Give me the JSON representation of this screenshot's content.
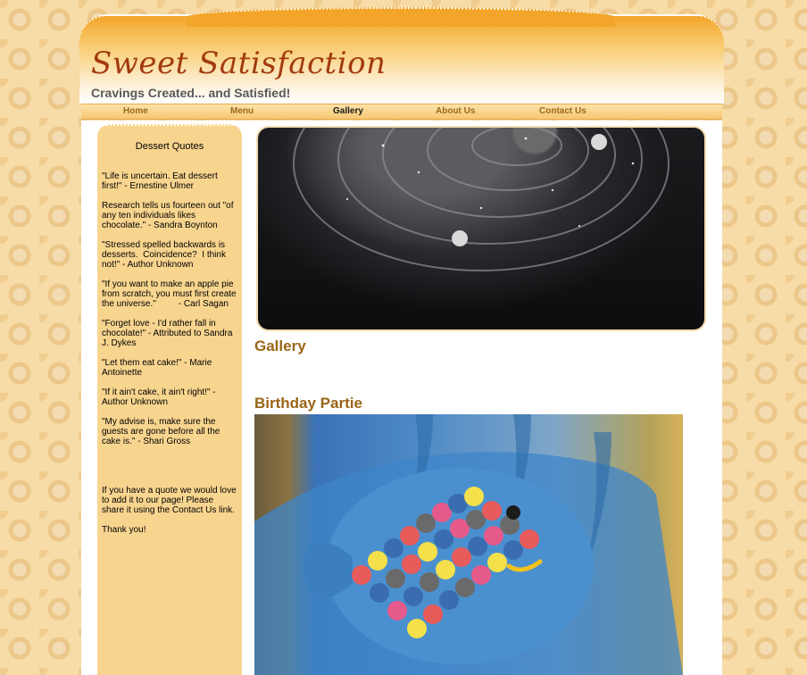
{
  "site": {
    "title": "Sweet Satisfaction",
    "tagline": "Cravings Created... and Satisfied!"
  },
  "nav": {
    "items": [
      {
        "label": "Home",
        "active": false
      },
      {
        "label": "Menu",
        "active": false
      },
      {
        "label": "Gallery",
        "active": true
      },
      {
        "label": "About Us",
        "active": false
      },
      {
        "label": "Contact Us",
        "active": false
      }
    ]
  },
  "sidebar": {
    "heading": "Dessert Quotes",
    "quotes": [
      "\"Life is uncertain. Eat dessert first!\" - Ernestine Ulmer",
      "Research tells us fourteen out \"of any ten individuals likes chocolate.\" - Sandra Boynton",
      "\"Stressed spelled backwards is desserts.  Coincidence?  I think not!\" - Author Unknown",
      "\"If you want to make an apple pie from scratch, you must first create the universe.\"         - Carl Sagan",
      "\"Forget love - I'd rather fall in chocolate!\" - Attributed to Sandra J. Dykes",
      "\"Let them eat cake!\" - Marie Antoinette",
      "\"If it ain't cake, it ain't right!\" - Author Unknown",
      "\"My advise is, make sure the guests are gone before all the cake is.\" - Shari Gross",
      "If you have a quote we would love to add it to our page! Please share it using the Contact Us link.",
      "Thank you!"
    ]
  },
  "main": {
    "heading": "Gallery",
    "section_heading": "Birthday Partie"
  },
  "colors": {
    "accent": "#f3a52a",
    "title": "#a23a0e",
    "heading": "#9a6516",
    "sidebar": "#f8d58f"
  }
}
